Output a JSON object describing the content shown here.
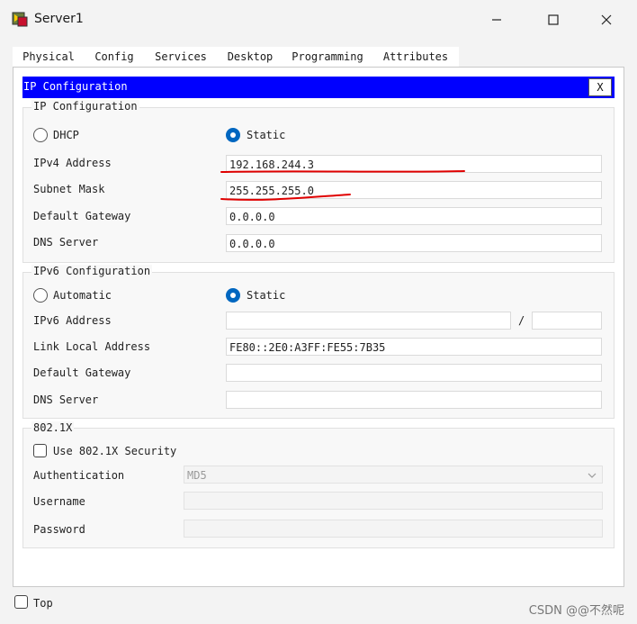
{
  "window": {
    "title": "Server1",
    "minimize_glyph": "—",
    "maximize_glyph": "☐",
    "close_glyph": "✕"
  },
  "tabs": [
    {
      "label": "Physical",
      "active": false
    },
    {
      "label": "Config",
      "active": false
    },
    {
      "label": "Services",
      "active": false
    },
    {
      "label": "Desktop",
      "active": true
    },
    {
      "label": "Programming",
      "active": false
    },
    {
      "label": "Attributes",
      "active": false
    }
  ],
  "dialog": {
    "title": "IP Configuration",
    "close_label": "X",
    "accent_color": "#0000ff"
  },
  "ipv4": {
    "legend": "IP Configuration",
    "dhcp_label": "DHCP",
    "static_label": "Static",
    "mode": "Static",
    "ipv4_address_label": "IPv4 Address",
    "ipv4_address": "192.168.244.3",
    "subnet_mask_label": "Subnet Mask",
    "subnet_mask": "255.255.255.0",
    "default_gateway_label": "Default Gateway",
    "default_gateway": "0.0.0.0",
    "dns_server_label": "DNS Server",
    "dns_server": "0.0.0.0"
  },
  "ipv6": {
    "legend": "IPv6 Configuration",
    "automatic_label": "Automatic",
    "static_label": "Static",
    "mode": "Static",
    "ipv6_address_label": "IPv6 Address",
    "ipv6_address": "",
    "prefix_separator": "/",
    "prefix_length": "",
    "link_local_label": "Link Local Address",
    "link_local_address": "FE80::2E0:A3FF:FE55:7B35",
    "default_gateway_label": "Default Gateway",
    "default_gateway": "",
    "dns_server_label": "DNS Server",
    "dns_server": ""
  },
  "dot1x": {
    "legend": "802.1X",
    "use_security_label": "Use 802.1X Security",
    "use_security_checked": false,
    "authentication_label": "Authentication",
    "authentication_value": "MD5",
    "username_label": "Username",
    "username": "",
    "password_label": "Password",
    "password": ""
  },
  "footer": {
    "top_label": "Top",
    "top_checked": false
  },
  "watermark": "CSDN @@不然呢",
  "annotation_color": "#e00000"
}
